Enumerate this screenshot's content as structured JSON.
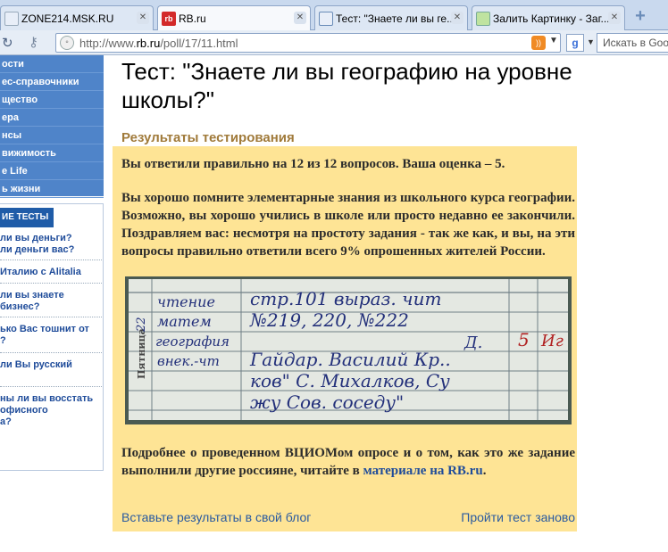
{
  "browser": {
    "tabs": [
      {
        "label": "ZONE214.MSK.RU",
        "active": false
      },
      {
        "label": "RB.ru",
        "active": true
      },
      {
        "label": "Тест: \"Знаете ли вы ге...",
        "active": false
      },
      {
        "label": "Залить Картинку - Заг...",
        "active": false
      }
    ],
    "new_tab": "+",
    "url_prefix": "http://www.",
    "url_host": "rb.ru",
    "url_path": "/poll/17/11.html",
    "search_placeholder": "Искать в Google",
    "search_engine": "g"
  },
  "sidebar": {
    "menu_items": [
      "ости",
      "ес-справочники",
      "щество",
      "ера",
      "нсы",
      "вижимость",
      "e Life",
      "ь жизни"
    ],
    "tests_header": "ИЕ ТЕСТЫ",
    "test_links": [
      " ли вы деньги?\nли деньги вас?",
      " Италию с Alitalia",
      " ли вы знаете\n бизнес?",
      "ько Вас тошнит от\n?",
      " ли Вы русский",
      "ны ли вы восстать\n офисного\nа?"
    ]
  },
  "main": {
    "title": "Тест: \"Знаете ли вы географию на уровне школы?\"",
    "results_heading": "Результаты тестирования",
    "score_line": "Вы ответили правильно на 12 из 12 вопросов. Ваша оценка – 5.",
    "result_text": "Вы хорошо помните элементарные знания из школьного курса географии. Возможно, вы хорошо учились в школе или просто недавно ее закончили. Поздравляем вас: несмотря на простоту задания - так же как, и вы, на эти вопросы правильно ответили всего 9% опрошенных жителей России.",
    "more_text": "Подробнее о проведенном ВЦИОМом опросе и о том, как это же задание выполнили другие россияне, читайте в ",
    "more_link": "материале на RB.ru",
    "more_end": ".",
    "blog_link": "Вставьте результаты в свой блог",
    "retake_link": "Пройти тест заново"
  },
  "diary": {
    "day": "Пятница",
    "date": "22",
    "subjects": [
      "чтение",
      "матем",
      "география",
      "внек.-чт"
    ],
    "lines": [
      "стр.101 вырaз. чит",
      "№219, 220, №222",
      "Гайдар. Василий Кр..",
      "ков\" С. Михалков, Су",
      "жу Сов. соседу\""
    ],
    "grade_letter": "Д.",
    "grade": "5",
    "signature": "Иг"
  },
  "colors": {
    "result_bg": "#fee495",
    "sidebar_blue": "#4f84c9",
    "link": "#1f4c9a",
    "heading_gold": "#a07a3a"
  }
}
